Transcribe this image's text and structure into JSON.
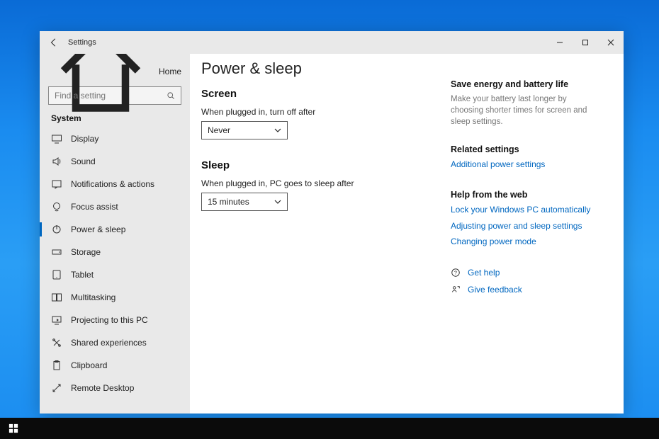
{
  "app": {
    "title": "Settings"
  },
  "sidebar": {
    "home_label": "Home",
    "search_placeholder": "Find a setting",
    "category": "System",
    "items": [
      {
        "label": "Display"
      },
      {
        "label": "Sound"
      },
      {
        "label": "Notifications & actions"
      },
      {
        "label": "Focus assist"
      },
      {
        "label": "Power & sleep"
      },
      {
        "label": "Storage"
      },
      {
        "label": "Tablet"
      },
      {
        "label": "Multitasking"
      },
      {
        "label": "Projecting to this PC"
      },
      {
        "label": "Shared experiences"
      },
      {
        "label": "Clipboard"
      },
      {
        "label": "Remote Desktop"
      }
    ]
  },
  "page": {
    "title": "Power & sleep",
    "screen": {
      "heading": "Screen",
      "label": "When plugged in, turn off after",
      "value": "Never"
    },
    "sleep": {
      "heading": "Sleep",
      "label": "When plugged in, PC goes to sleep after",
      "value": "15 minutes"
    }
  },
  "aside": {
    "energy_heading": "Save energy and battery life",
    "energy_text": "Make your battery last longer by choosing shorter times for screen and sleep settings.",
    "related_heading": "Related settings",
    "related_link": "Additional power settings",
    "help_heading": "Help from the web",
    "help_links": [
      "Lock your Windows PC automatically",
      "Adjusting power and sleep settings",
      "Changing power mode"
    ],
    "get_help": "Get help",
    "feedback": "Give feedback"
  }
}
